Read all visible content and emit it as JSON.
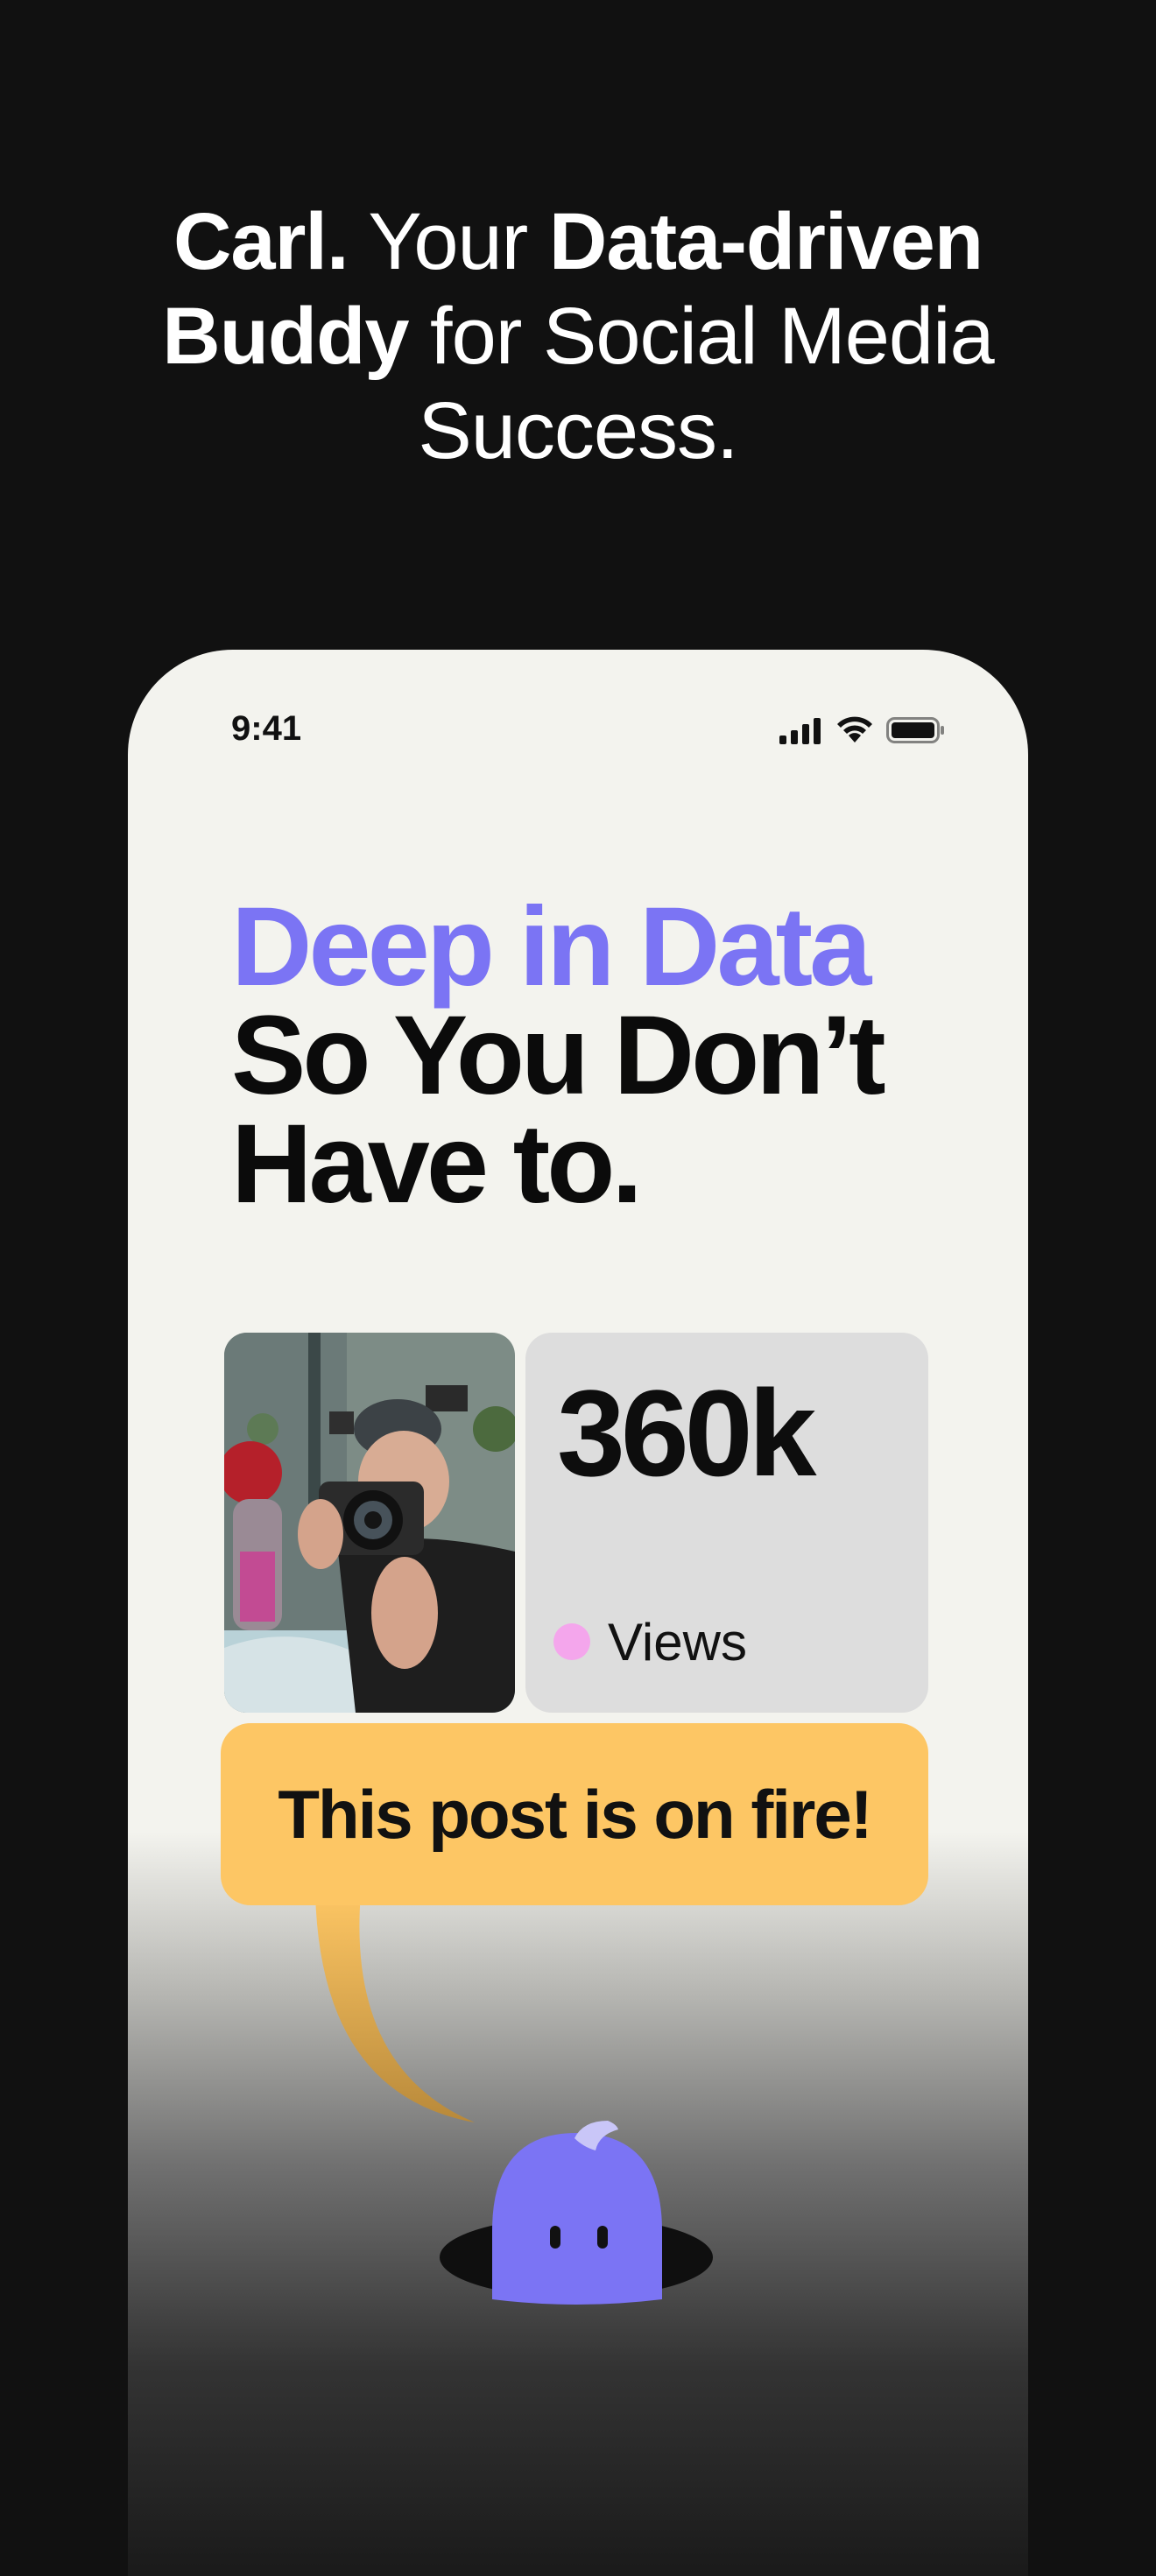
{
  "headline": {
    "part1_bold": "Carl.",
    "part2": " Your ",
    "part3_bold": "Data-driven",
    "part4_bold": "Buddy",
    "part5": " for Social Media",
    "part6": "Success."
  },
  "phone": {
    "status_bar": {
      "time": "9:41",
      "icons": [
        "signal-icon",
        "wifi-icon",
        "battery-icon"
      ]
    },
    "hero": {
      "accent_line": "Deep in Data",
      "line2": "So You Don’t",
      "line3": "Have to."
    },
    "stat": {
      "value": "360k",
      "label": "Views"
    },
    "bubble": {
      "text": "This post is on fire!"
    },
    "mascot": "mascot-ghost-icon"
  },
  "colors": {
    "background": "#111111",
    "phone_bg": "#f3f3ee",
    "accent_purple": "#7b74f4",
    "bubble_yellow": "#fdc664",
    "dot_pink": "#f4a6ec",
    "stat_card": "#dddddd"
  }
}
